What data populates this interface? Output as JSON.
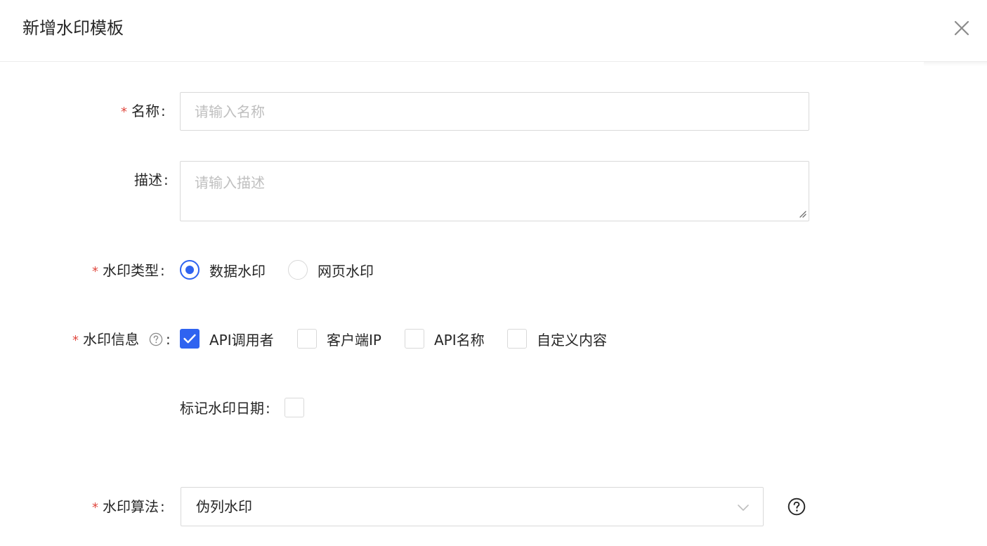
{
  "dialog": {
    "title": "新增水印模板",
    "close_icon": "close-icon"
  },
  "form": {
    "name": {
      "label": "名称",
      "required": true,
      "placeholder": "请输入名称",
      "value": ""
    },
    "description": {
      "label": "描述",
      "required": false,
      "placeholder": "请输入描述",
      "value": ""
    },
    "watermark_type": {
      "label": "水印类型",
      "required": true,
      "options": [
        {
          "label": "数据水印",
          "selected": true
        },
        {
          "label": "网页水印",
          "selected": false
        }
      ]
    },
    "watermark_info": {
      "label": "水印信息",
      "required": true,
      "help_icon": "question-circle-icon",
      "options": [
        {
          "label": "API调用者",
          "checked": true
        },
        {
          "label": "客户端IP",
          "checked": false
        },
        {
          "label": "API名称",
          "checked": false
        },
        {
          "label": "自定义内容",
          "checked": false
        }
      ]
    },
    "mark_date": {
      "label": "标记水印日期",
      "checked": false
    },
    "algorithm": {
      "label": "水印算法",
      "required": true,
      "value": "伪列水印",
      "dropdown_icon": "chevron-down-icon",
      "help_icon": "question-circle-icon"
    },
    "colon": ":"
  },
  "colors": {
    "primary": "#2f63f0",
    "required": "#e0483f",
    "border": "#d9d9d9",
    "placeholder": "#bfbfbf"
  }
}
